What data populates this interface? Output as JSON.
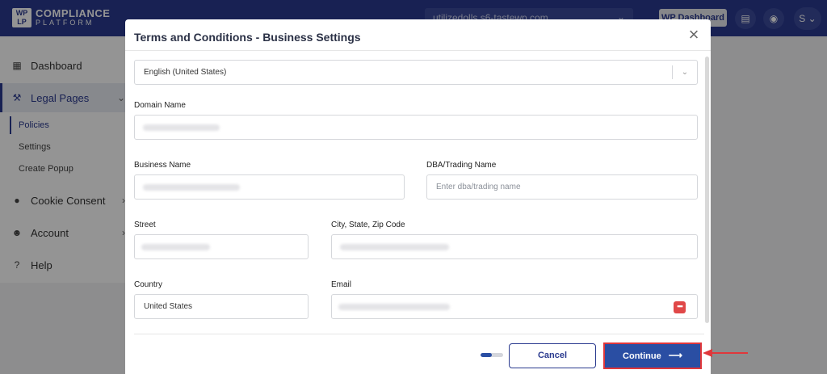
{
  "app": {
    "logo_mark": "WP LP",
    "logo_line1": "COMPLIANCE",
    "logo_line2": "PLATFORM",
    "site_selector": "utilizedolls.s6-tastewp.com",
    "wp_dashboard_label": "WP Dashboard",
    "user_initial": "S"
  },
  "sidebar": {
    "items": [
      {
        "label": "Dashboard",
        "icon": "dashboard-icon"
      },
      {
        "label": "Legal Pages",
        "icon": "gavel-icon"
      },
      {
        "label": "Cookie Consent",
        "icon": "cookie-icon"
      },
      {
        "label": "Account",
        "icon": "user-settings-icon"
      },
      {
        "label": "Help",
        "icon": "help-icon"
      }
    ],
    "sub_items": [
      {
        "label": "Policies"
      },
      {
        "label": "Settings"
      },
      {
        "label": "Create Popup"
      }
    ]
  },
  "modal": {
    "title": "Terms and Conditions - Business Settings",
    "language": "English (United States)",
    "fields": {
      "domain_name": {
        "label": "Domain Name",
        "value": ""
      },
      "business_name": {
        "label": "Business Name",
        "value": ""
      },
      "dba": {
        "label": "DBA/Trading Name",
        "placeholder": "Enter dba/trading name"
      },
      "street": {
        "label": "Street",
        "value": ""
      },
      "city_state_zip": {
        "label": "City, State, Zip Code",
        "value": ""
      },
      "country": {
        "label": "Country",
        "value": "United States"
      },
      "email": {
        "label": "Email",
        "value": ""
      }
    },
    "progress": 0.5,
    "cancel_label": "Cancel",
    "continue_label": "Continue"
  },
  "colors": {
    "brand": "#2a3a8f",
    "primary_button": "#2a4ea3",
    "highlight": "#e0373b"
  }
}
